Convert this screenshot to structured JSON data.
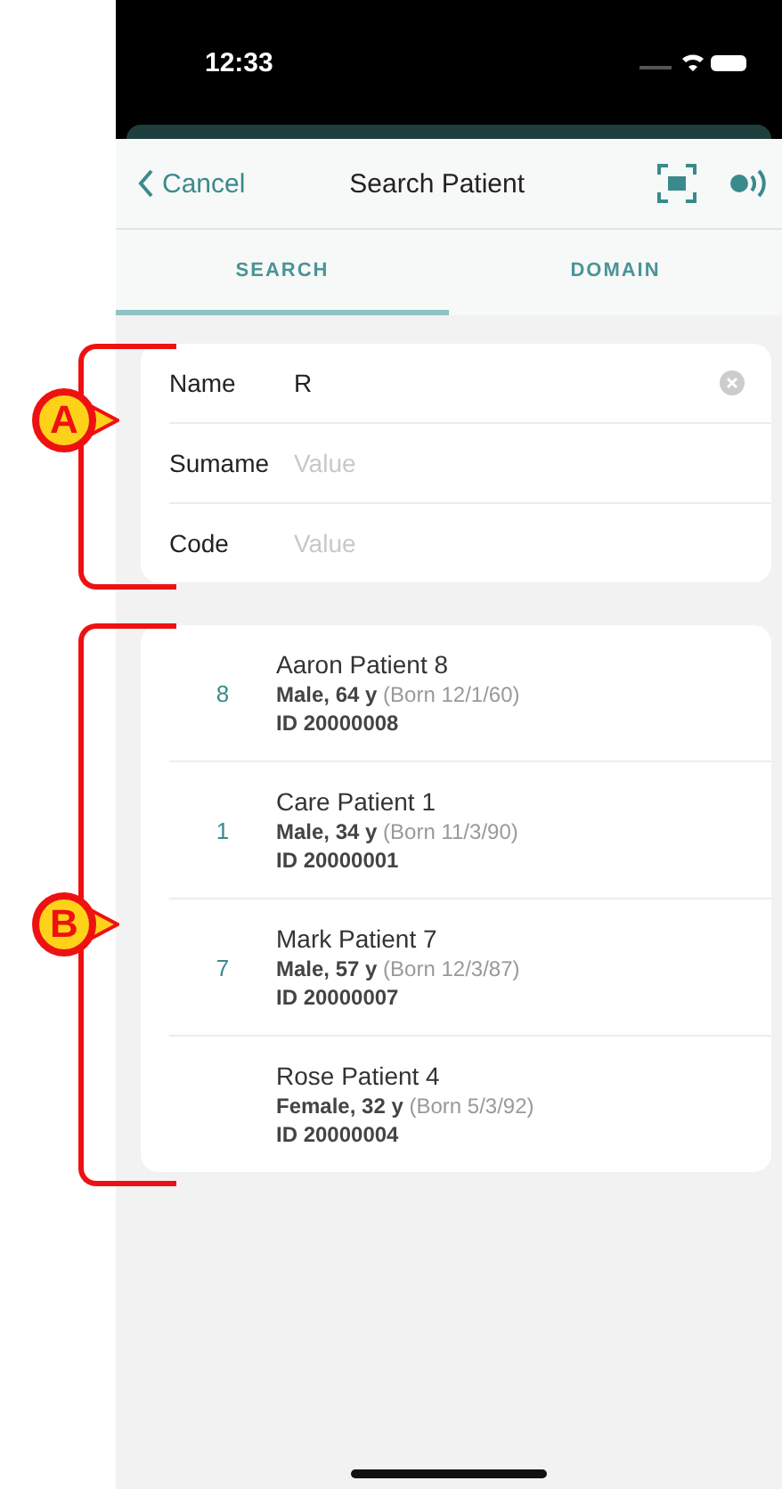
{
  "status_bar": {
    "time": "12:33"
  },
  "nav": {
    "back": "Cancel",
    "title": "Search Patient"
  },
  "tabs": [
    {
      "label": "SEARCH",
      "selected": true
    },
    {
      "label": "DOMAIN",
      "selected": false
    }
  ],
  "form": [
    {
      "label": "Name",
      "value": "R"
    },
    {
      "label": "Sumame",
      "placeholder": "Value"
    },
    {
      "label": "Code",
      "placeholder": "Value"
    }
  ],
  "patients": [
    {
      "bed": "8",
      "name": "Aaron Patient 8",
      "summary": "Male, 64 y",
      "born": "(Born 12/1/60)",
      "id": "ID 20000008"
    },
    {
      "bed": "1",
      "name": "Care Patient 1",
      "summary": "Male, 34 y",
      "born": "(Born 11/3/90)",
      "id": "ID 20000001"
    },
    {
      "bed": "7",
      "name": "Mark Patient 7",
      "summary": "Male, 57 y",
      "born": "(Born 12/3/87)",
      "id": "ID 20000007"
    },
    {
      "name": "Rose Patient 4",
      "summary": "Female, 32 y",
      "born": "(Born 5/3/92)",
      "id": "ID 20000004"
    }
  ],
  "callouts": [
    {
      "label": "A"
    },
    {
      "label": "B"
    }
  ]
}
